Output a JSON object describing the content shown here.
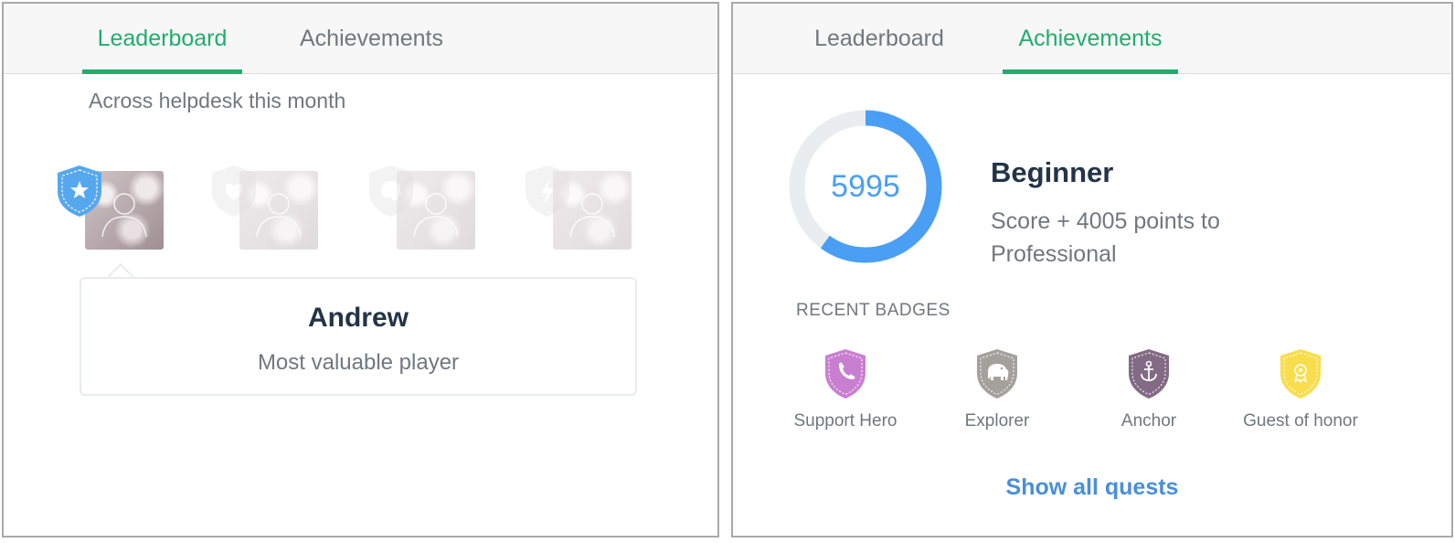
{
  "leaderboard_panel": {
    "tabs": [
      {
        "label": "Leaderboard",
        "active": true
      },
      {
        "label": "Achievements",
        "active": false
      }
    ],
    "subtitle": "Across helpdesk this month",
    "players": [
      {
        "badge_icon": "star-icon",
        "selected": true
      },
      {
        "badge_icon": "heart-icon",
        "selected": false
      },
      {
        "badge_icon": "brain-icon",
        "selected": false
      },
      {
        "badge_icon": "lightning-icon",
        "selected": false
      }
    ],
    "card": {
      "name": "Andrew",
      "description": "Most valuable player"
    }
  },
  "achievements_panel": {
    "tabs": [
      {
        "label": "Leaderboard",
        "active": false
      },
      {
        "label": "Achievements",
        "active": true
      }
    ],
    "score": "5995",
    "progress_fraction": 0.6,
    "level": "Beginner",
    "next_level_text": "Score + 4005 points to Professional",
    "recent_badges_heading": "RECENT BADGES",
    "badges": [
      {
        "label": "Support Hero",
        "icon": "phone-icon",
        "color": "#c97fd0"
      },
      {
        "label": "Explorer",
        "icon": "elephant-icon",
        "color": "#a3a19c"
      },
      {
        "label": "Anchor",
        "icon": "anchor-icon",
        "color": "#836b86"
      },
      {
        "label": "Guest of honor",
        "icon": "medal-icon",
        "color": "#f8de4d"
      }
    ],
    "show_all_label": "Show all quests"
  },
  "colors": {
    "accent_green": "#1fae6b",
    "progress_blue": "#4a9ff5",
    "ring_track": "#e9edf0",
    "leader_shield_blue": "#56a8ee",
    "link_blue": "#4a8fd9"
  }
}
